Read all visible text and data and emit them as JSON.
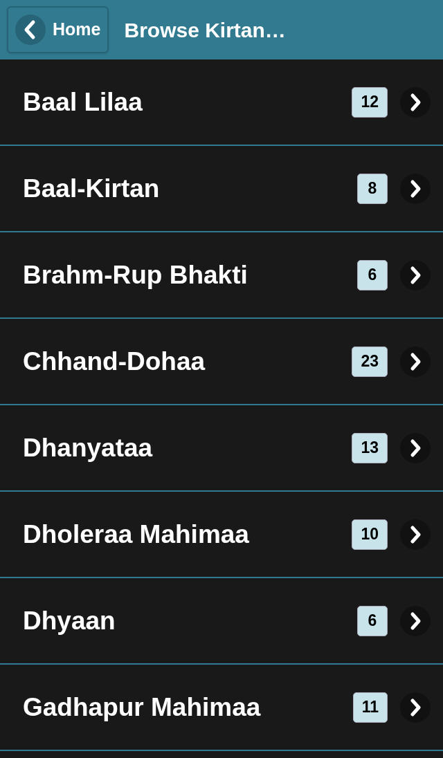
{
  "header": {
    "back_button": "Home",
    "title": "Browse Kirtan…"
  },
  "items": [
    {
      "label": "Baal Lilaa",
      "count": "12"
    },
    {
      "label": "Baal-Kirtan",
      "count": "8"
    },
    {
      "label": "Brahm-Rup Bhakti",
      "count": "6"
    },
    {
      "label": "Chhand-Dohaa",
      "count": "23"
    },
    {
      "label": "Dhanyataa",
      "count": "13"
    },
    {
      "label": "Dholeraa Mahimaa",
      "count": "10"
    },
    {
      "label": "Dhyaan",
      "count": "6"
    },
    {
      "label": "Gadhapur Mahimaa",
      "count": "11"
    }
  ]
}
